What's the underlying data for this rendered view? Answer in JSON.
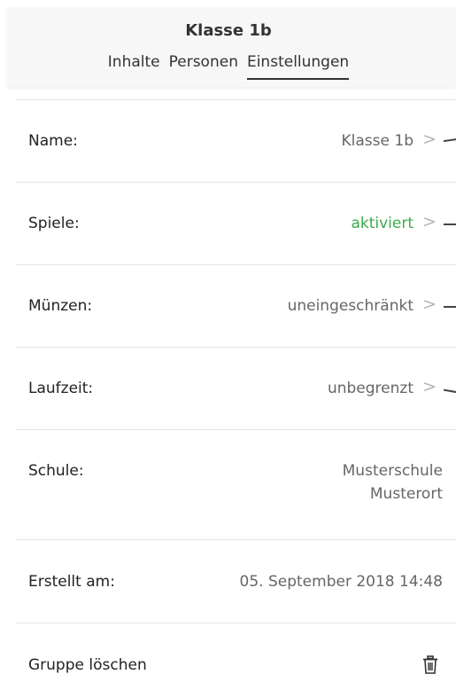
{
  "header": {
    "title": "Klasse 1b",
    "tabs": [
      {
        "label": "Inhalte",
        "active": false
      },
      {
        "label": "Personen",
        "active": false
      },
      {
        "label": "Einstellungen",
        "active": true
      }
    ]
  },
  "settings": {
    "name": {
      "label": "Name:",
      "value": "Klasse 1b"
    },
    "spiele": {
      "label": "Spiele:",
      "value": "aktiviert",
      "value_color": "#3bab49"
    },
    "muenzen": {
      "label": "Münzen:",
      "value": "uneingeschränkt"
    },
    "laufzeit": {
      "label": "Laufzeit:",
      "value": "unbegrenzt"
    },
    "schule": {
      "label": "Schule:",
      "value_line1": "Musterschule",
      "value_line2": "Musterort"
    },
    "erstellt": {
      "label": "Erstellt am:",
      "value": "05. September 2018 14:48"
    },
    "loeschen": {
      "label": "Gruppe löschen",
      "icon": "trash-icon"
    }
  },
  "chevron_glyph": ">"
}
